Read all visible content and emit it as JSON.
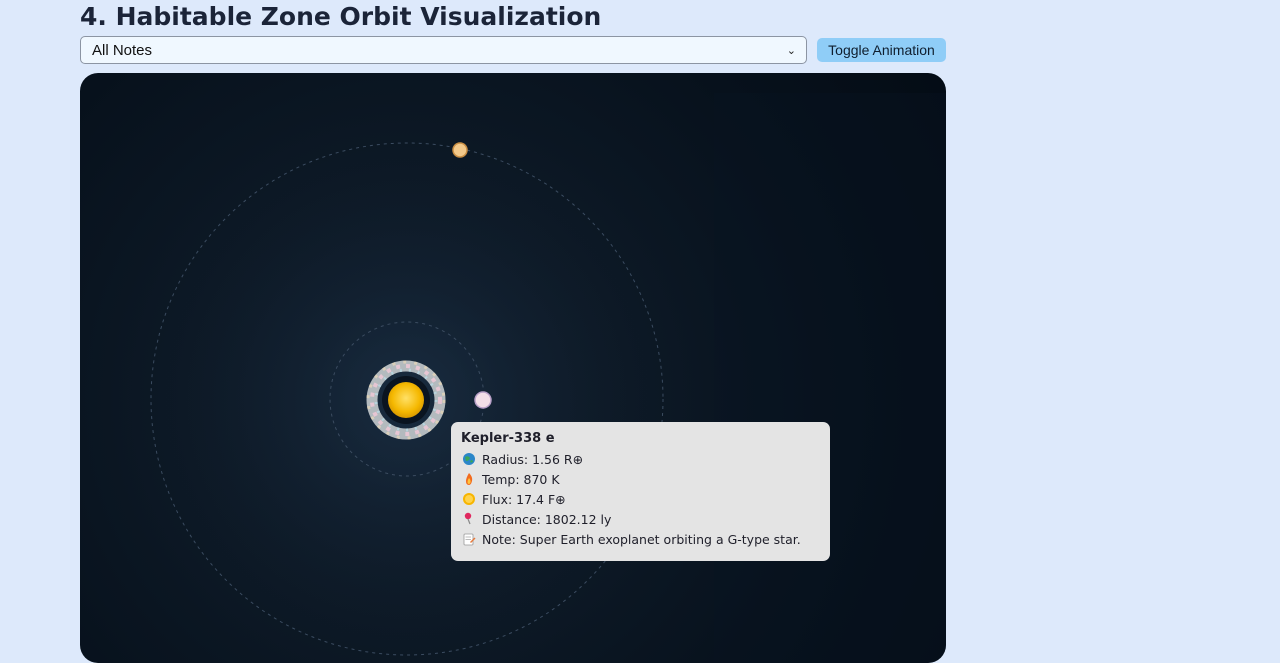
{
  "page": {
    "title": "4. Habitable Zone Orbit Visualization"
  },
  "controls": {
    "filter_selected": "All Notes",
    "toggle_label": "Toggle Animation"
  },
  "tooltip": {
    "planet_name": "Kepler-338 e",
    "radius_label": "Radius: 1.56 R⊕",
    "temp_label": "Temp: 870 K",
    "flux_label": "Flux: 17.4 F⊕",
    "distance_label": "Distance: 1802.12 ly",
    "note_label": "Note: Super Earth exoplanet orbiting a G-type star.",
    "icons": [
      "globe-icon",
      "fire-icon",
      "sun-icon",
      "pin-icon",
      "memo-icon"
    ]
  },
  "colors": {
    "page_bg": "#dde9fb",
    "button_bg": "#8fcdf7",
    "canvas_bg": "#07111c",
    "star": "#f5b800",
    "outer_planet": "#f3c98a",
    "inner_planet": "#f3dfe8"
  }
}
